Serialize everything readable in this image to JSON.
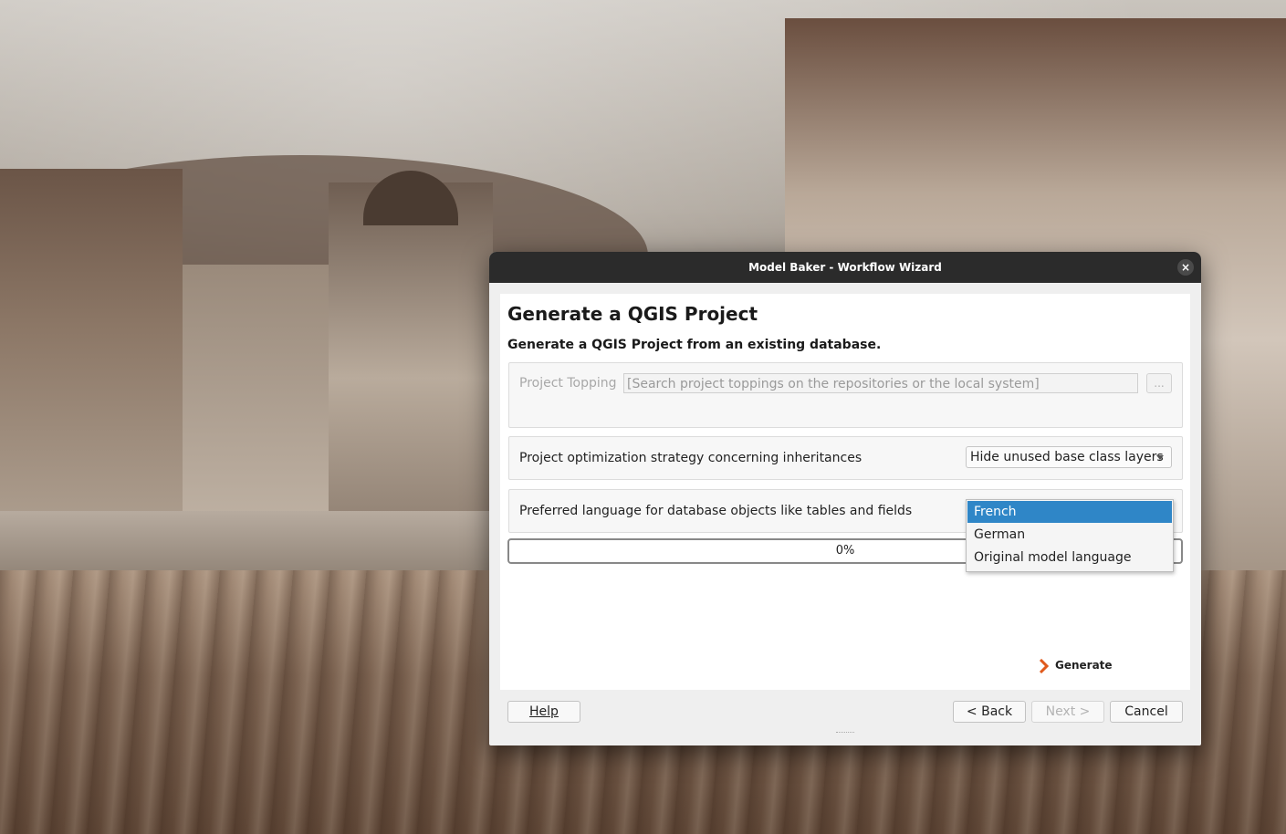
{
  "window": {
    "title": "Model Baker - Workflow Wizard",
    "close_glyph": "×"
  },
  "page": {
    "title": "Generate a QGIS Project",
    "subtitle": "Generate a QGIS Project from an existing database."
  },
  "topping": {
    "label": "Project Topping",
    "placeholder": "[Search project toppings on the repositories or the local system]",
    "browse_label": "..."
  },
  "optimization": {
    "label": "Project optimization strategy concerning inheritances",
    "selected": "Hide unused base class layers"
  },
  "language": {
    "label": "Preferred language for database objects like tables and fields",
    "options": [
      "French",
      "German",
      "Original model language"
    ],
    "selected_index": 0
  },
  "progress": {
    "value": 0,
    "text": "0%"
  },
  "actions": {
    "generate_label": "Generate"
  },
  "footer": {
    "help_label": "Help",
    "back_label": "< Back",
    "next_label": "Next >",
    "cancel_label": "Cancel"
  },
  "colors": {
    "accent": "#2f86c7",
    "titlebar": "#2b2b2b",
    "generate_icon": "#e05a1c"
  },
  "icons": {
    "close": "close-icon",
    "generate": "chevron-right-icon",
    "combo": "chevron-down-icon"
  }
}
